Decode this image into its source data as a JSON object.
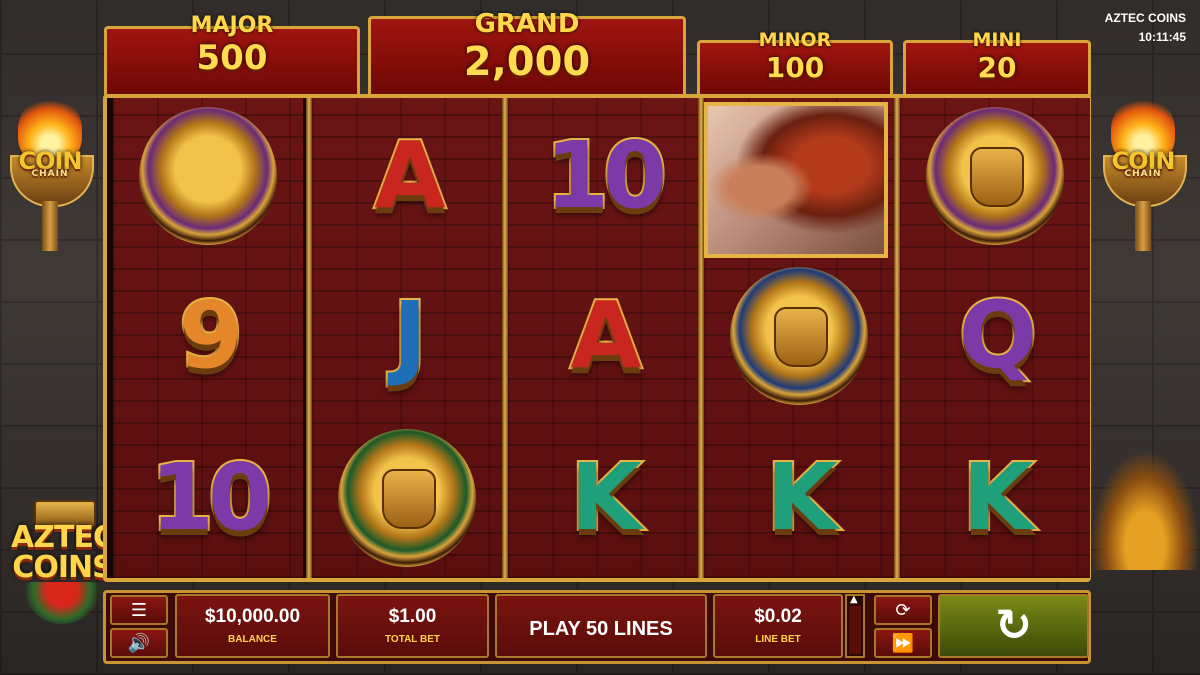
{
  "game": {
    "title": "AZTEC COINS",
    "clock": "10:11:45"
  },
  "jackpots": [
    {
      "name": "MAJOR",
      "value": "500"
    },
    {
      "name": "GRAND",
      "value": "2,000"
    },
    {
      "name": "MINOR",
      "value": "100"
    },
    {
      "name": "MINI",
      "value": "20"
    }
  ],
  "torches": {
    "badge_top": "COIN",
    "badge_sub": "CHAIN"
  },
  "logo": {
    "line1": "AZTEC",
    "line2": "COINS"
  },
  "reels": [
    [
      "eagle-medal",
      "9",
      "10"
    ],
    [
      "A",
      "J",
      "jaguar-warrior-medal"
    ],
    [
      "10",
      "A",
      "K"
    ],
    [
      "aztec-chief-portrait",
      "mask-medal",
      "K"
    ],
    [
      "idol-medal",
      "Q",
      "K"
    ]
  ],
  "controls": {
    "balance_value": "$10,000.00",
    "balance_label": "BALANCE",
    "total_bet_value": "$1.00",
    "total_bet_label": "TOTAL BET",
    "lines_label": "PLAY 50 LINES",
    "line_bet_value": "$0.02",
    "line_bet_label": "LINE BET",
    "menu_icon": "☰",
    "sound_icon": "🔊",
    "autoplay_icon": "⟳",
    "fast_icon": "⏩",
    "spin_icon": "↻"
  },
  "colors": {
    "frame_gold": "#d8a53a",
    "reel_red": "#6a1414",
    "jackpot_red": "#a0150f",
    "spin_green": "#7a8a16"
  }
}
